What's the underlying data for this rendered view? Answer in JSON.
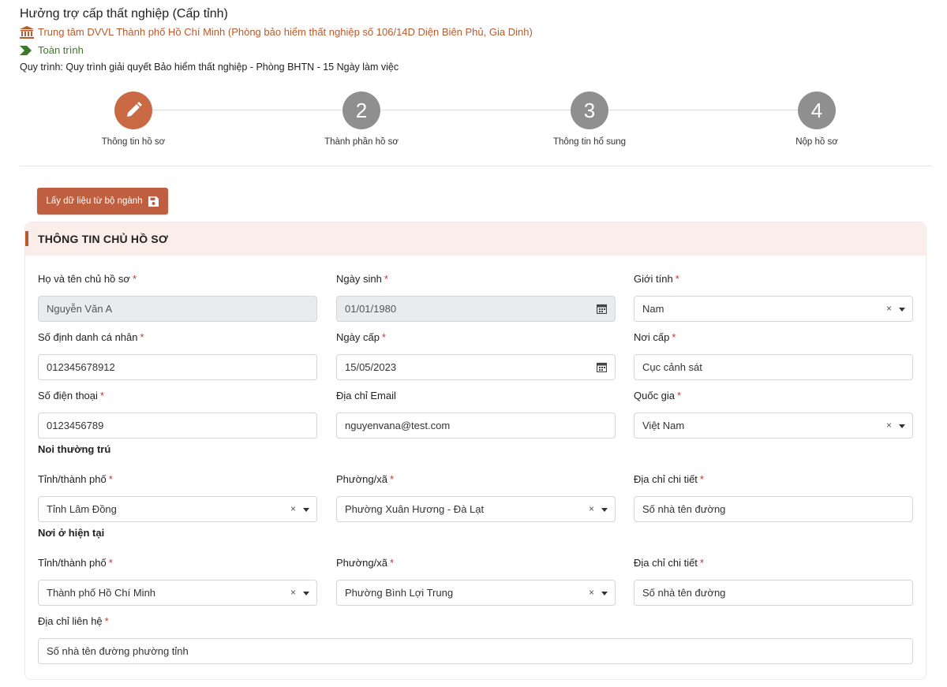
{
  "header": {
    "title": "Hưởng trợ cấp thất nghiệp (Cấp tỉnh)",
    "agency": "Trung tâm DVVL Thành phố Hồ Chí Minh (Phòng bảo hiểm thất nghiệp số 106/14D Diện Biên Phủ, Gia Dinh)",
    "scope": "Toàn trình",
    "process": "Quy trình: Quy trình giải quyết Bảo hiểm thất nghiệp - Phòng BHTN - 15 Ngày làm việc"
  },
  "steps": [
    {
      "num": "",
      "label": "Thông tin hồ sơ",
      "icon": "pencil-icon"
    },
    {
      "num": "2",
      "label": "Thành phần hồ sơ"
    },
    {
      "num": "3",
      "label": "Thông tin hổ sung"
    },
    {
      "num": "4",
      "label": "Nộp hồ sơ"
    }
  ],
  "fetch_button": {
    "label": "Lấy dữ liệu từ bộ ngành",
    "icon": "save-icon"
  },
  "card": {
    "title": "THÔNG TIN CHỦ HỒ SƠ"
  },
  "form": {
    "full_name": {
      "label": "Họ và tên chủ hồ sơ",
      "value": "Nguyễn Văn A"
    },
    "dob": {
      "label": "Ngày sinh",
      "value": "01/01/1980"
    },
    "gender": {
      "label": "Giới tính",
      "value": "Nam"
    },
    "id_number": {
      "label": "Số định danh cá nhân",
      "value": "012345678912"
    },
    "issue_date": {
      "label": "Ngày cấp",
      "value": "15/05/2023"
    },
    "issue_place": {
      "label": "Nơi cấp",
      "value": "Cục cảnh sát"
    },
    "phone": {
      "label": "Số điện thoại",
      "value": "0123456789"
    },
    "email": {
      "label": "Địa chỉ Email",
      "value": "nguyenvana@test.com"
    },
    "country": {
      "label": "Quốc gia",
      "value": "Việt Nam"
    },
    "permanent_section": "Noi thường trú",
    "perm_province": {
      "label": "Tỉnh/thành phố",
      "value": "Tỉnh Lâm Đồng"
    },
    "perm_ward": {
      "label": "Phường/xã",
      "value": "Phường Xuân Hương - Đà Lạt"
    },
    "perm_address": {
      "label": "Địa chỉ chi tiết",
      "placeholder": "Số nhà tên đường"
    },
    "current_section": "Nơi ở hiện tại",
    "cur_province": {
      "label": "Tỉnh/thành phố",
      "value": "Thành phố Hồ Chí Minh"
    },
    "cur_ward": {
      "label": "Phường/xã",
      "value": "Phường Bình Lợi Trung"
    },
    "cur_address": {
      "label": "Địa chỉ chi tiết",
      "placeholder": "Số nhà tên đường"
    },
    "contact_address": {
      "label": "Địa chỉ liên hệ",
      "value": "Số nhà tên đường phường tỉnh"
    }
  },
  "colors": {
    "accent": "#c96a45",
    "brand_orange": "#b85a2c",
    "scope_green": "#3b7a28",
    "required_red": "#c0392b"
  }
}
